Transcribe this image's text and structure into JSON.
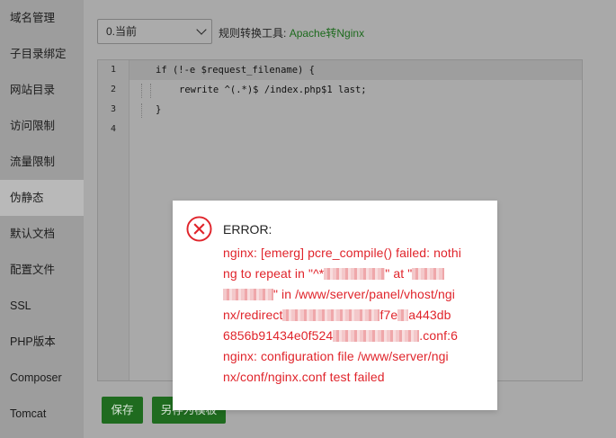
{
  "sidebar": {
    "items": [
      {
        "label": "域名管理"
      },
      {
        "label": "子目录绑定"
      },
      {
        "label": "网站目录"
      },
      {
        "label": "访问限制"
      },
      {
        "label": "流量限制"
      },
      {
        "label": "伪静态",
        "active": true
      },
      {
        "label": "默认文档"
      },
      {
        "label": "配置文件"
      },
      {
        "label": "SSL"
      },
      {
        "label": "PHP版本"
      },
      {
        "label": "Composer"
      },
      {
        "label": "Tomcat"
      }
    ]
  },
  "toolbar": {
    "select_value": "0.当前",
    "tool_label": "规则转换工具:",
    "tool_link": "Apache转Nginx"
  },
  "editor": {
    "line_numbers": [
      "1",
      "2",
      "3",
      "4"
    ],
    "lines": [
      "if (!-e $request_filename) {",
      "rewrite ^(.*)$ /index.php$1 last;",
      "}",
      ""
    ]
  },
  "buttons": {
    "save": "保存",
    "save_as_template": "另存为模板"
  },
  "dialog": {
    "title": "ERROR:",
    "lines": [
      "nginx: [emerg] pcre_compile() failed: nothi",
      "ng to repeat in \"^*",
      "\" in /www/server/panel/vhost/ngi",
      "nx/redirect",
      "f7e",
      "a443db",
      "6856b91434e0f524",
      ".conf:6",
      "nginx: configuration file /www/server/ngi",
      "nx/conf/nginx.conf test failed"
    ],
    "extra": "\" at \""
  },
  "colors": {
    "error_red": "#e0242b",
    "brand_green": "#1f6b1f",
    "link_green": "#1d6a1d"
  }
}
